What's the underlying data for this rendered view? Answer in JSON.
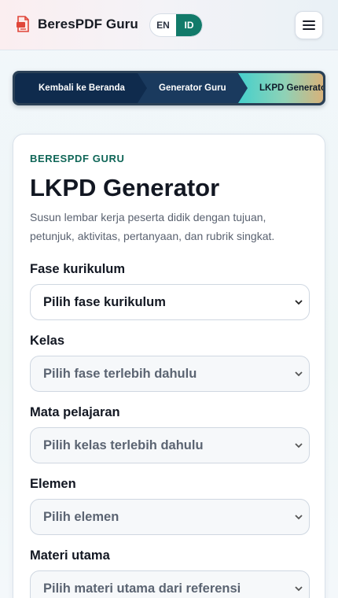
{
  "header": {
    "brand": "BeresPDF Guru",
    "lang": {
      "en": "EN",
      "id": "ID",
      "active": "ID"
    },
    "colors": {
      "accent": "#127a6a",
      "brand_icon": "#e0463a"
    }
  },
  "breadcrumb": {
    "items": [
      {
        "label": "Kembali ke Beranda"
      },
      {
        "label": "Generator Guru"
      },
      {
        "label": "LKPD Generator"
      }
    ]
  },
  "page": {
    "eyebrow": "BERESPDF GURU",
    "title": "LKPD Generator",
    "description": "Susun lembar kerja peserta didik dengan tujuan, petunjuk, aktivitas, pertanyaan, dan rubrik singkat."
  },
  "form": {
    "fields": [
      {
        "label": "Fase kurikulum",
        "value": "Pilih fase kurikulum",
        "enabled": true
      },
      {
        "label": "Kelas",
        "value": "Pilih fase terlebih dahulu",
        "enabled": false
      },
      {
        "label": "Mata pelajaran",
        "value": "Pilih kelas terlebih dahulu",
        "enabled": false
      },
      {
        "label": "Elemen",
        "value": "Pilih elemen",
        "enabled": false
      },
      {
        "label": "Materi utama",
        "value": "Pilih materi utama dari referensi",
        "enabled": false
      }
    ]
  }
}
